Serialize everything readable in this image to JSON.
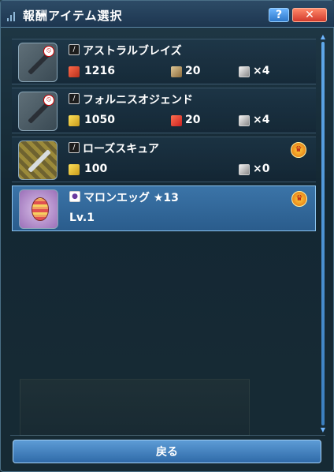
{
  "window": {
    "title": "報酬アイテム選択",
    "help_label": "?",
    "close_label": "✕"
  },
  "items": [
    {
      "name": "アストラルブレイズ",
      "name_icon": "sword-icon",
      "stats": [
        {
          "icon": "attack-icon",
          "value": "1216"
        },
        {
          "icon": "element-icon",
          "value": "20"
        },
        {
          "icon": "slot-icon",
          "value": "×4"
        }
      ],
      "thumb": "dark-blade",
      "restricted": true,
      "crown": false,
      "selected": false
    },
    {
      "name": "フォルニスオジェンド",
      "name_icon": "blade-icon",
      "stats": [
        {
          "icon": "key-icon",
          "value": "1050"
        },
        {
          "icon": "fire-icon",
          "value": "20"
        },
        {
          "icon": "slot-icon",
          "value": "×4"
        }
      ],
      "thumb": "dark-blade",
      "restricted": true,
      "crown": false,
      "selected": false
    },
    {
      "name": "ローズスキュア",
      "name_icon": "sword-icon",
      "stats": [
        {
          "icon": "key-icon",
          "value": "100"
        },
        {
          "icon": "slot-icon",
          "value": "×0"
        }
      ],
      "thumb": "gold-blade",
      "restricted": false,
      "crown": true,
      "selected": false
    },
    {
      "name": "マロンエッグ ★13",
      "name_icon": "egg-icon",
      "level": "Lv.1",
      "thumb": "egg",
      "restricted": false,
      "crown": true,
      "selected": true
    }
  ],
  "footer": {
    "back_label": "戻る"
  },
  "colors": {
    "title_bar": "#2d4b66",
    "selected_row": "#3b74a8",
    "button": "#5d9cd6"
  }
}
